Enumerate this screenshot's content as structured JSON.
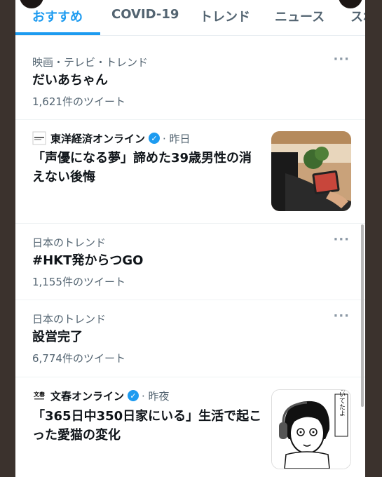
{
  "tabs": [
    {
      "label": "おすすめ"
    },
    {
      "label": "COVID-19"
    },
    {
      "label": "トレンド"
    },
    {
      "label": "ニュース"
    },
    {
      "label": "スポ"
    }
  ],
  "feed": {
    "trend1": {
      "meta": "映画・テレビ・トレンド",
      "title": "だいあちゃん",
      "count": "1,621件のツイート"
    },
    "news1": {
      "source": "東洋経済オンライン",
      "time": "· 昨日",
      "logo_text": "東洋経済",
      "title": "「声優になる夢」諦めた39歳男性の消えない後悔"
    },
    "trend2": {
      "meta": "日本のトレンド",
      "title": "#HKT発からつGO",
      "count": "1,155件のツイート"
    },
    "trend3": {
      "meta": "日本のトレンド",
      "title": "設営完了",
      "count": "6,774件のツイート"
    },
    "news2": {
      "source": "文春オンライン",
      "time": "· 昨夜",
      "logo_text": "文春",
      "title": "「365日中350日家にいる」生活で起こった愛猫の変化",
      "thumb_caption": "鳴いてたよ"
    }
  },
  "icons": {
    "more": "more-horizontal-icon",
    "verified": "verified-badge-icon"
  },
  "colors": {
    "accent": "#1d9bf0",
    "text": "#0f1419",
    "muted": "#536471",
    "divider": "#eff3f4"
  }
}
